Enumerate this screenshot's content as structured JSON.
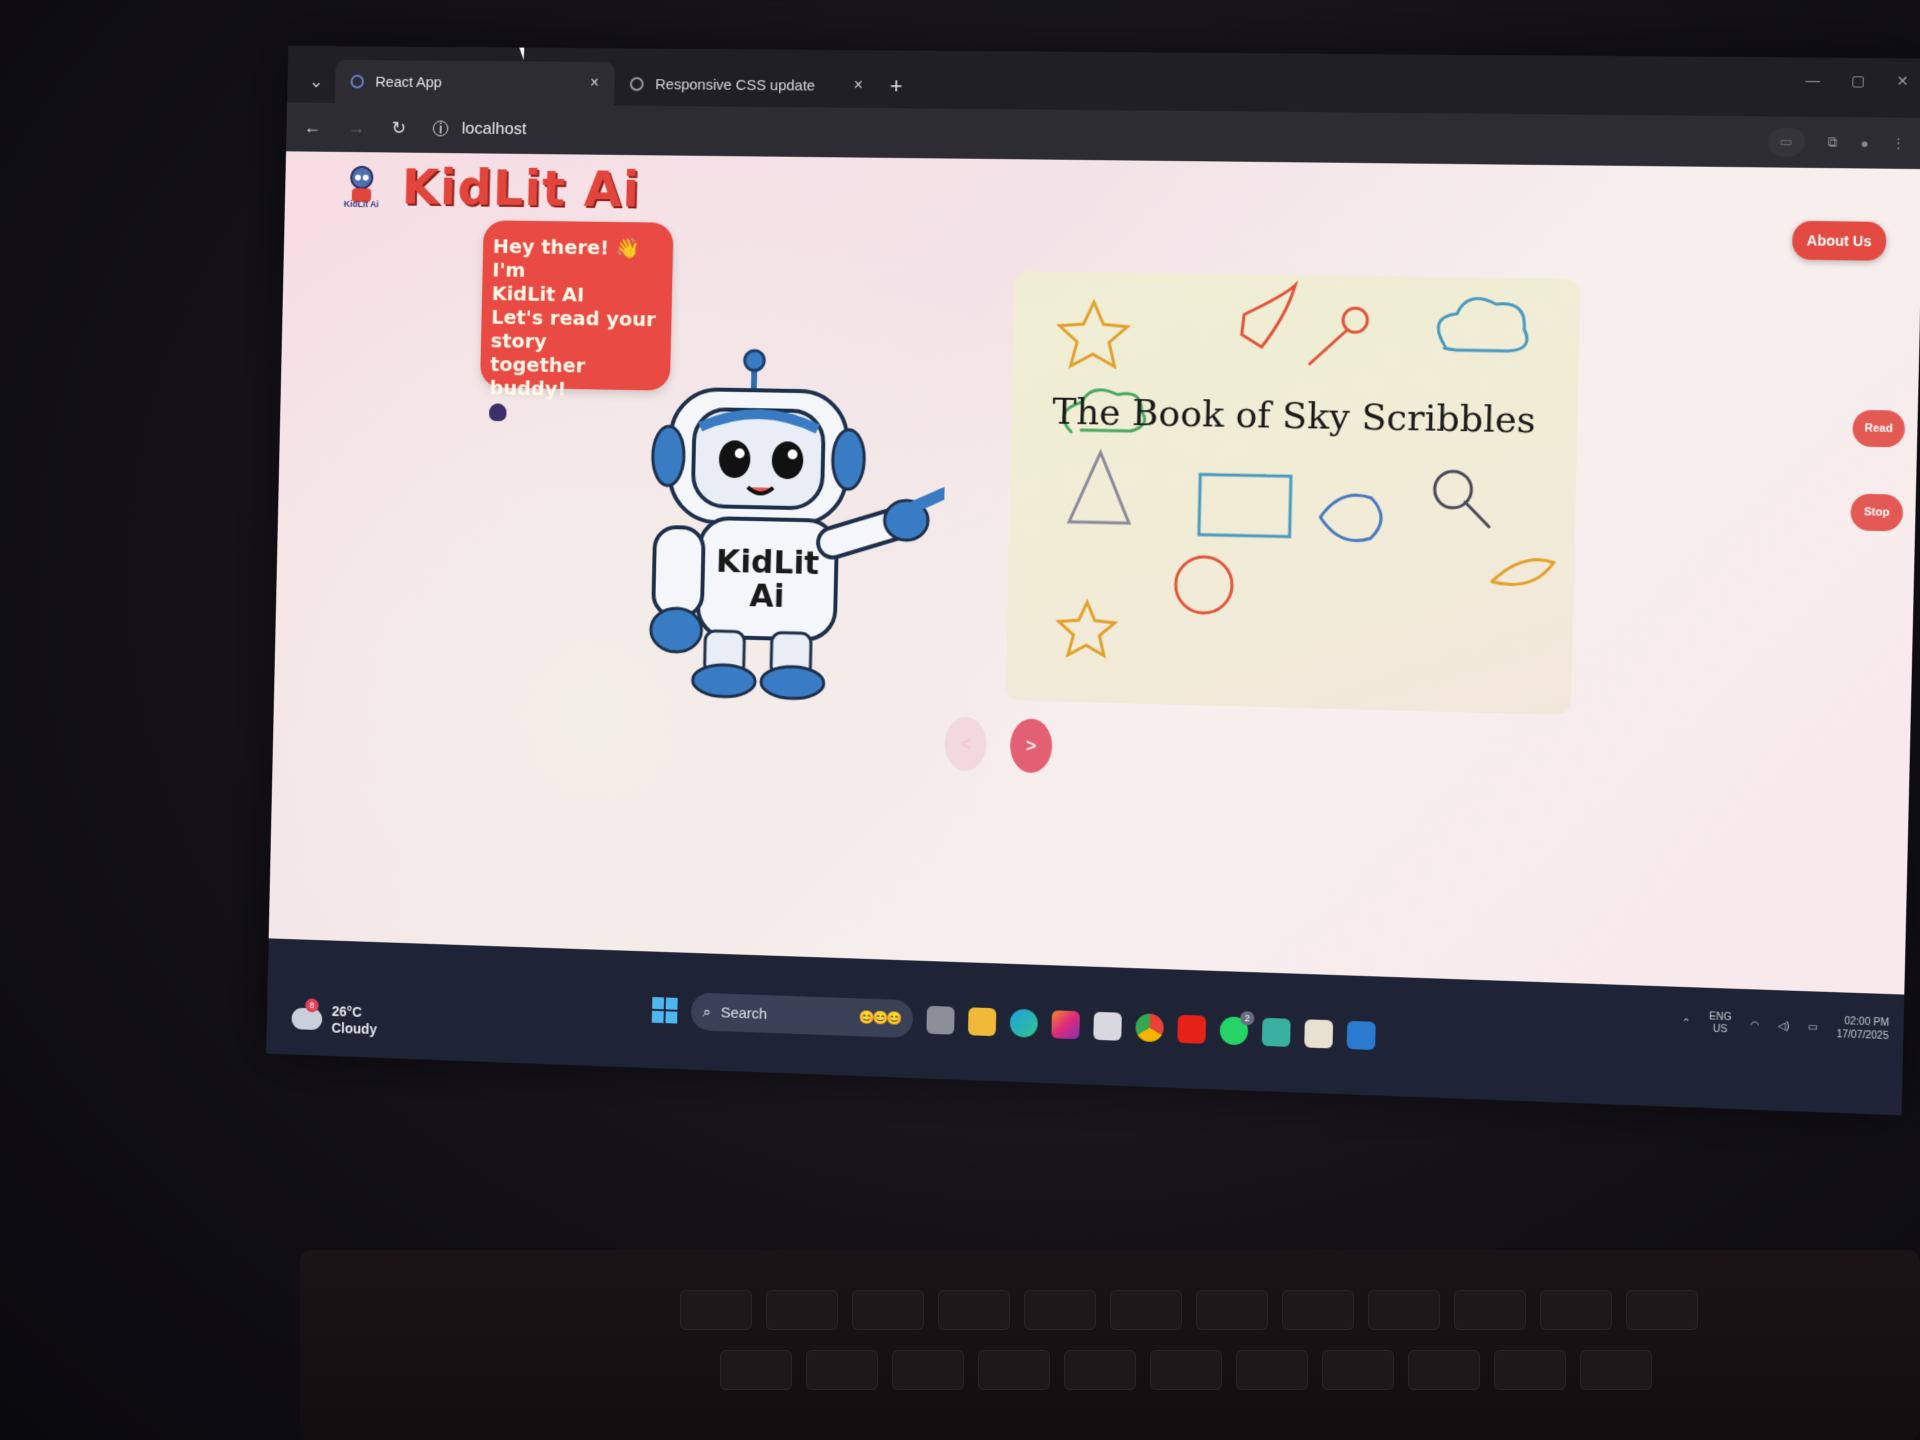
{
  "browser": {
    "tabs": [
      {
        "title": "React App",
        "active": true
      },
      {
        "title": "Responsive CSS update",
        "active": false
      }
    ],
    "new_tab_label": "+",
    "close_label": "×",
    "url": "localhost"
  },
  "page": {
    "logo_text": "KidLit Ai",
    "logo_caption": "KidLit Ai",
    "about_label": "About Us",
    "read_label": "Read",
    "stop_label": "Stop",
    "bubble": {
      "line1": "Hey there! 👋 I'm",
      "line2": "KidLit AI",
      "line3": "Let's read your",
      "line4": "story",
      "line5": "together buddy!"
    },
    "robot_shirt_line1": "KidLit",
    "robot_shirt_line2": "Ai",
    "book_title": "The Book of Sky Scribbles",
    "prev_label": "<",
    "next_label": ">"
  },
  "taskbar": {
    "weather_badge": "8",
    "temperature": "26°C",
    "condition": "Cloudy",
    "search_label": "Search",
    "search_emojis": "😊😊😊",
    "lang_line1": "ENG",
    "lang_line2": "US",
    "time": "02:00 PM",
    "date": "17/07/2025",
    "notif_badge": "2"
  },
  "colors": {
    "accent": "#e2453c",
    "bubble": "#e94a43",
    "next_button": "#e35f72",
    "taskbar": "#1e2436"
  },
  "icons": {
    "tab_dropdown": "chevron-down-icon",
    "back": "back-arrow-icon",
    "reload": "reload-icon",
    "site_info": "info-icon",
    "windows": "windows-logo-icon",
    "search": "search-icon"
  }
}
